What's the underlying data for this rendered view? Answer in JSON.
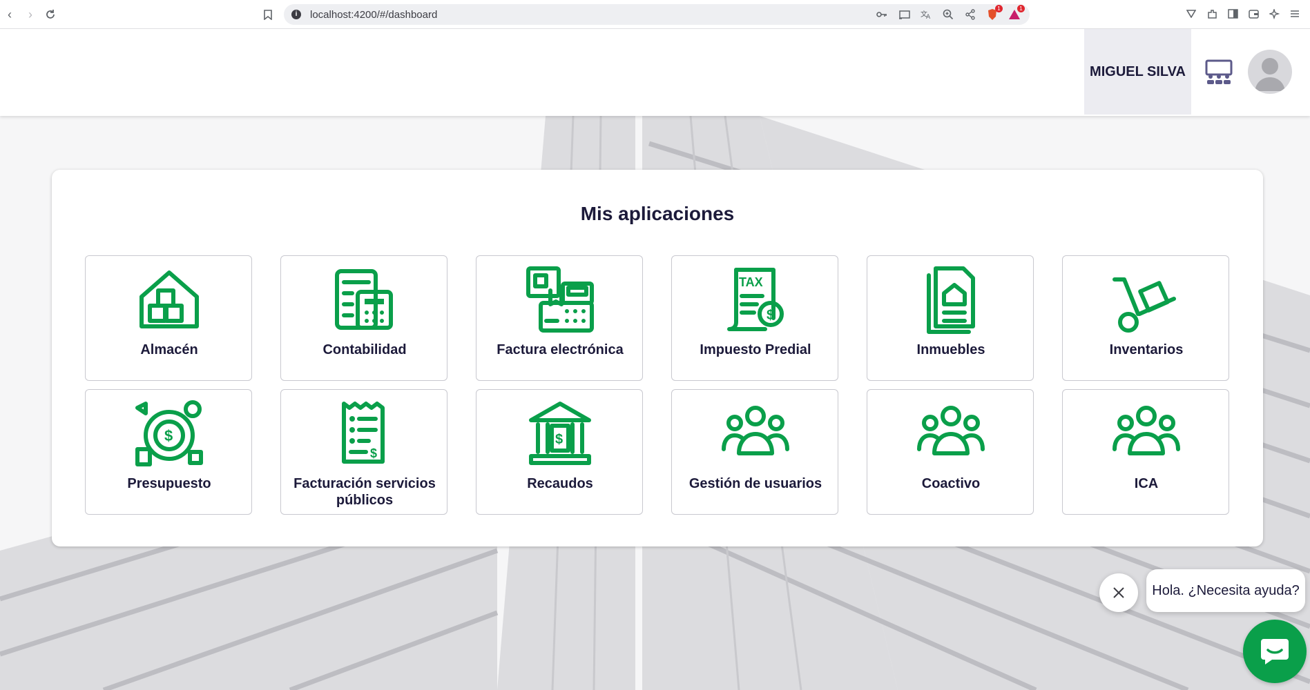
{
  "browser": {
    "url": "localhost:4200/#/dashboard",
    "info_glyph": "i",
    "badge_brave": "1",
    "badge_alert": "1"
  },
  "header": {
    "user_name": "MIGUEL SILVA"
  },
  "card": {
    "title": "Mis aplicaciones",
    "apps": [
      {
        "label": "Almacén",
        "icon": "warehouse-icon"
      },
      {
        "label": "Contabilidad",
        "icon": "calculator-icon"
      },
      {
        "label": "Factura electrónica",
        "icon": "cash-register-icon"
      },
      {
        "label": "Impuesto Predial",
        "icon": "tax-document-icon"
      },
      {
        "label": "Inmuebles",
        "icon": "property-document-icon"
      },
      {
        "label": "Inventarios",
        "icon": "hand-truck-icon"
      },
      {
        "label": "Presupuesto",
        "icon": "budget-icon"
      },
      {
        "label": "Facturación servicios públicos",
        "icon": "bill-icon"
      },
      {
        "label": "Recaudos",
        "icon": "bank-icon"
      },
      {
        "label": "Gestión de usuarios",
        "icon": "users-icon"
      },
      {
        "label": "Coactivo",
        "icon": "users-icon"
      },
      {
        "label": "ICA",
        "icon": "users-icon"
      }
    ]
  },
  "chat": {
    "greeting": "Hola. ¿Necesita ayuda?"
  },
  "colors": {
    "accent": "#0a9f4a",
    "text": "#1c1a3a"
  }
}
